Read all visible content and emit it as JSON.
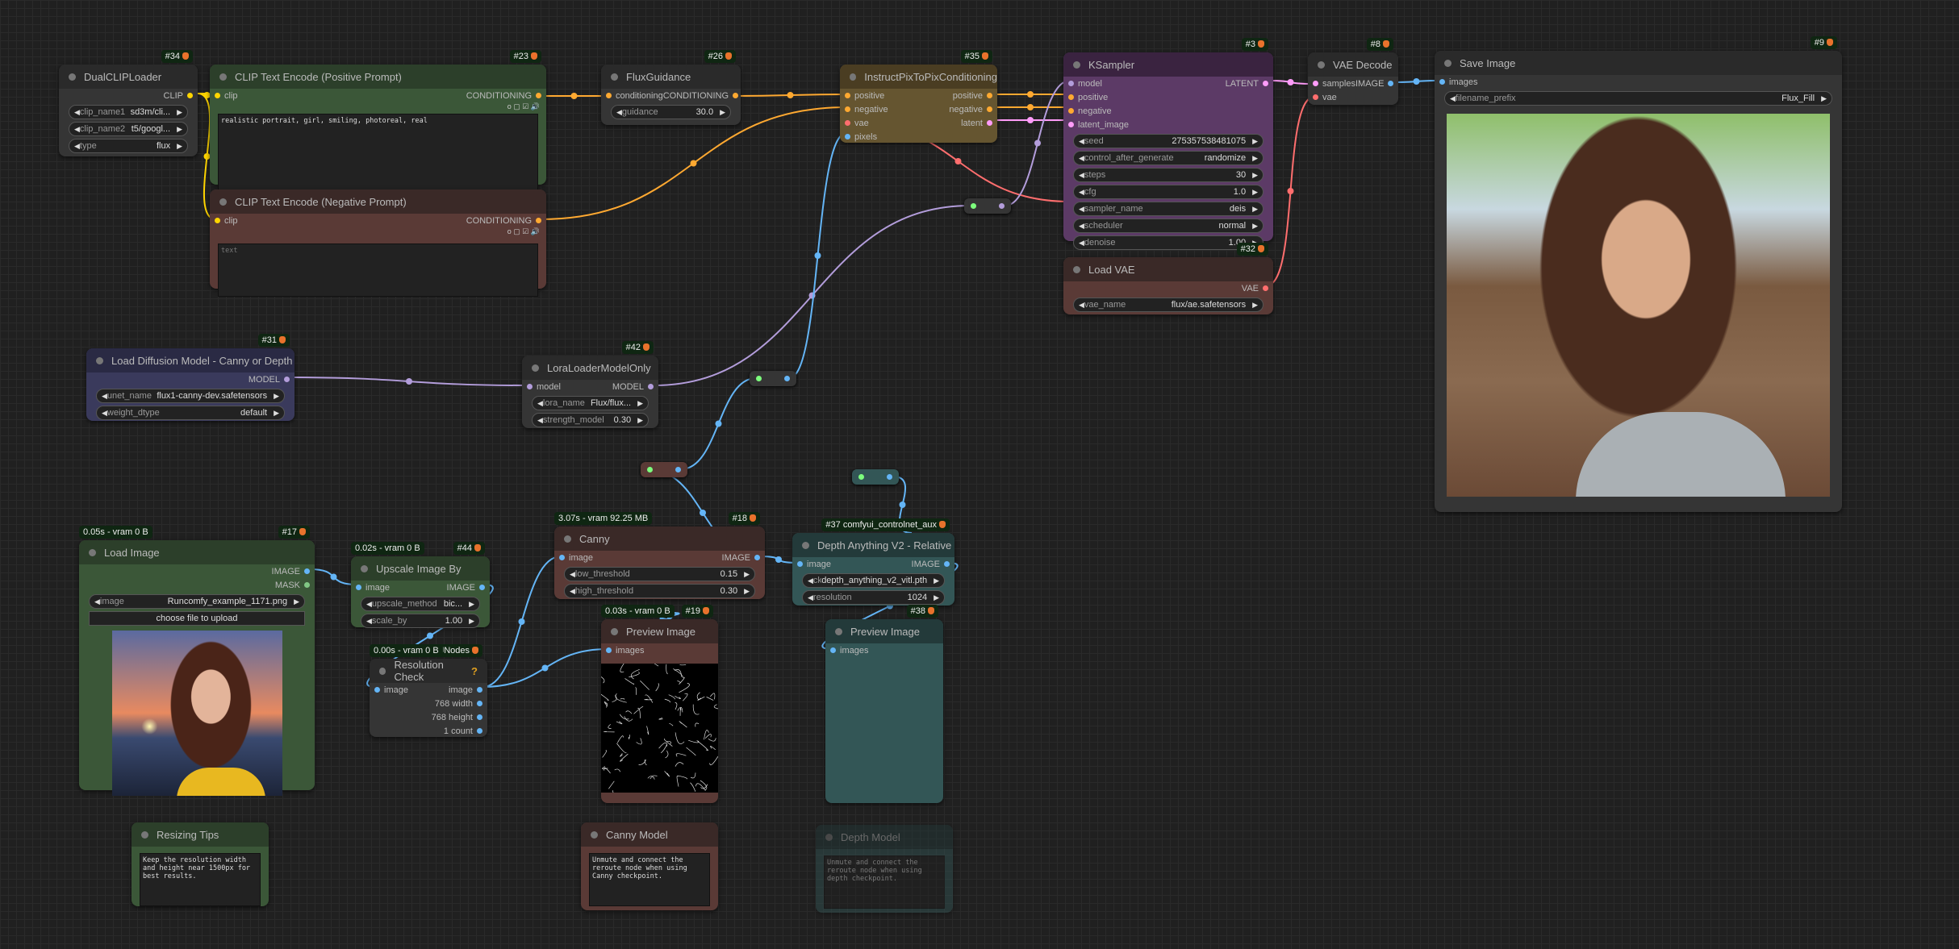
{
  "nodes": [
    {
      "id": "34",
      "key": "dualcliploader",
      "title": "DualCLIPLoader",
      "badge": "#34",
      "inputs": [],
      "outputs": [
        {
          "name": "CLIP",
          "type": "CLIP"
        }
      ],
      "widgets": [
        {
          "label": "clip_name1",
          "value": "sd3m/cli..."
        },
        {
          "label": "clip_name2",
          "value": "t5/googl..."
        },
        {
          "label": "type",
          "value": "flux"
        }
      ]
    },
    {
      "id": "23",
      "key": "clip-text-encode-positive",
      "title": "CLIP Text Encode (Positive Prompt)",
      "badge": "#23",
      "inputs": [
        {
          "name": "clip",
          "type": "CLIP"
        }
      ],
      "outputs": [
        {
          "name": "CONDITIONING",
          "type": "CONDITIONING"
        }
      ],
      "toggles": "o ▢ ☑ 🔊",
      "text": "realistic portrait, girl, smiling, photoreal, real",
      "placeholder": ""
    },
    {
      "id": "neg",
      "key": "clip-text-encode-negative",
      "title": "CLIP Text Encode (Negative Prompt)",
      "inputs": [
        {
          "name": "clip",
          "type": "CLIP"
        }
      ],
      "outputs": [
        {
          "name": "CONDITIONING",
          "type": "CONDITIONING"
        }
      ],
      "toggles": "o ▢ ☑ 🔊",
      "text": "",
      "placeholder": "text"
    },
    {
      "id": "26",
      "key": "fluxguidance",
      "title": "FluxGuidance",
      "badge": "#26",
      "inputs": [
        {
          "name": "conditioning",
          "type": "CONDITIONING"
        }
      ],
      "outputs": [
        {
          "name": "CONDITIONING",
          "type": "CONDITIONING"
        }
      ],
      "widgets": [
        {
          "label": "guidance",
          "value": "30.0"
        }
      ]
    },
    {
      "id": "35",
      "key": "instructpixtopixconditioning",
      "title": "InstructPixToPixConditioning",
      "badge": "#35",
      "inputs": [
        {
          "name": "positive",
          "type": "CONDITIONING"
        },
        {
          "name": "negative",
          "type": "CONDITIONING"
        },
        {
          "name": "vae",
          "type": "VAE"
        },
        {
          "name": "pixels",
          "type": "IMAGE"
        }
      ],
      "outputs": [
        {
          "name": "positive",
          "type": "CONDITIONING"
        },
        {
          "name": "negative",
          "type": "CONDITIONING"
        },
        {
          "name": "latent",
          "type": "LATENT"
        }
      ]
    },
    {
      "id": "3",
      "key": "ksampler",
      "title": "KSampler",
      "badge": "#3",
      "inputs": [
        {
          "name": "model",
          "type": "MODEL"
        },
        {
          "name": "positive",
          "type": "CONDITIONING"
        },
        {
          "name": "negative",
          "type": "CONDITIONING"
        },
        {
          "name": "latent_image",
          "type": "LATENT"
        }
      ],
      "outputs": [
        {
          "name": "LATENT",
          "type": "LATENT"
        }
      ],
      "widgets": [
        {
          "label": "seed",
          "value": "275357538481075"
        },
        {
          "label": "control_after_generate",
          "value": "randomize"
        },
        {
          "label": "steps",
          "value": "30"
        },
        {
          "label": "cfg",
          "value": "1.0"
        },
        {
          "label": "sampler_name",
          "value": "deis"
        },
        {
          "label": "scheduler",
          "value": "normal"
        },
        {
          "label": "denoise",
          "value": "1.00"
        }
      ]
    },
    {
      "id": "32",
      "key": "load-vae",
      "title": "Load VAE",
      "badge": "#32",
      "inputs": [],
      "outputs": [
        {
          "name": "VAE",
          "type": "VAE"
        }
      ],
      "widgets": [
        {
          "label": "vae_name",
          "value": "flux/ae.safetensors"
        }
      ]
    },
    {
      "id": "8",
      "key": "vae-decode",
      "title": "VAE Decode",
      "badge": "#8",
      "inputs": [
        {
          "name": "samples",
          "type": "LATENT"
        },
        {
          "name": "vae",
          "type": "VAE"
        }
      ],
      "outputs": [
        {
          "name": "IMAGE",
          "type": "IMAGE"
        }
      ]
    },
    {
      "id": "9",
      "key": "save-image",
      "title": "Save Image",
      "badge": "#9",
      "inputs": [
        {
          "name": "images",
          "type": "IMAGE"
        }
      ],
      "outputs": [],
      "widgets": [
        {
          "label": "filename_prefix",
          "value": "Flux_Fill"
        }
      ],
      "image": "save"
    },
    {
      "id": "31",
      "key": "load-diffusion-model",
      "title": "Load Diffusion Model - Canny or Depth",
      "badge": "#31",
      "inputs": [],
      "outputs": [
        {
          "name": "MODEL",
          "type": "MODEL"
        }
      ],
      "widgets": [
        {
          "label": "unet_name",
          "value": "flux1-canny-dev.safetensors"
        },
        {
          "label": "weight_dtype",
          "value": "default"
        }
      ]
    },
    {
      "id": "42",
      "key": "loraloadermodelonly",
      "title": "LoraLoaderModelOnly",
      "badge": "#42",
      "inputs": [
        {
          "name": "model",
          "type": "MODEL"
        }
      ],
      "outputs": [
        {
          "name": "MODEL",
          "type": "MODEL"
        }
      ],
      "widgets": [
        {
          "label": "lora_name",
          "value": "Flux/flux..."
        },
        {
          "label": "strength_model",
          "value": "0.30"
        }
      ]
    },
    {
      "id": "17",
      "key": "load-image",
      "title": "Load Image",
      "badge": "#17",
      "timing": "0.05s - vram 0 B",
      "inputs": [],
      "outputs": [
        {
          "name": "IMAGE",
          "type": "IMAGE"
        },
        {
          "name": "MASK",
          "type": "MASK"
        }
      ],
      "widgets": [
        {
          "label": "image",
          "value": "Runcomfy_example_1171.png"
        }
      ],
      "button": "choose file to upload",
      "image": "load"
    },
    {
      "id": "44",
      "key": "upscale-image-by",
      "title": "Upscale Image By",
      "badge": "#44",
      "timing": "0.02s - vram 0 B",
      "inputs": [
        {
          "name": "image",
          "type": "IMAGE"
        }
      ],
      "outputs": [
        {
          "name": "IMAGE",
          "type": "IMAGE"
        }
      ],
      "widgets": [
        {
          "label": "upscale_method",
          "value": "bic..."
        },
        {
          "label": "scale_by",
          "value": "1.00"
        }
      ]
    },
    {
      "id": "46",
      "key": "resolution-check",
      "title": "Resolution Check",
      "badge": "#46 KJNodes",
      "timing": "0.00s - vram 0 B",
      "help": "?",
      "inputs": [
        {
          "name": "image",
          "type": "IMAGE"
        }
      ],
      "outputs": [
        {
          "name": "image",
          "type": "IMAGE"
        },
        {
          "name": "768 width",
          "type": "INT"
        },
        {
          "name": "768 height",
          "type": "INT"
        },
        {
          "name": "1 count",
          "type": "INT"
        }
      ]
    },
    {
      "id": "18",
      "key": "canny",
      "title": "Canny",
      "badge": "#18",
      "timing": "3.07s - vram 92.25 MB",
      "inputs": [
        {
          "name": "image",
          "type": "IMAGE"
        }
      ],
      "outputs": [
        {
          "name": "IMAGE",
          "type": "IMAGE"
        }
      ],
      "widgets": [
        {
          "label": "low_threshold",
          "value": "0.15"
        },
        {
          "label": "high_threshold",
          "value": "0.30"
        }
      ]
    },
    {
      "id": "37",
      "key": "depth-anything-v2",
      "title": "Depth Anything V2 - Relative",
      "badge": "#37 comfyui_controlnet_aux",
      "inputs": [
        {
          "name": "image",
          "type": "IMAGE"
        }
      ],
      "outputs": [
        {
          "name": "IMAGE",
          "type": "IMAGE"
        }
      ],
      "widgets": [
        {
          "label": "ckpt_name",
          "value": "depth_anything_v2_vitl.pth"
        },
        {
          "label": "resolution",
          "value": "1024"
        }
      ]
    },
    {
      "id": "19",
      "key": "preview-image-canny",
      "title": "Preview Image",
      "badge": "#19",
      "timing": "0.03s - vram 0 B",
      "inputs": [
        {
          "name": "images",
          "type": "IMAGE"
        }
      ],
      "outputs": [],
      "image": "canny"
    },
    {
      "id": "38",
      "key": "preview-image-depth",
      "title": "Preview Image",
      "badge": "#38",
      "inputs": [
        {
          "name": "images",
          "type": "IMAGE"
        }
      ],
      "outputs": []
    },
    {
      "id": "n1",
      "key": "note-resizing-tips",
      "title": "Resizing Tips",
      "inputs": [],
      "outputs": [],
      "text": "Keep the resolution width and height near 1500px for best results."
    },
    {
      "id": "n2",
      "key": "note-canny-model",
      "title": "Canny Model",
      "inputs": [],
      "outputs": [],
      "text": "Unmute and connect the reroute node when using Canny checkpoint."
    },
    {
      "id": "n3",
      "key": "note-depth-model",
      "title": "Depth Model",
      "inputs": [],
      "outputs": [],
      "text": "Unmute and connect the reroute node when using depth checkpoint.",
      "muted": true
    }
  ],
  "slot_colors": {
    "CLIP": "#ffd500",
    "CONDITIONING": "#ffa931",
    "MODEL": "#b39ddb",
    "LATENT": "#ff9cf9",
    "VAE": "#ff6e6e",
    "IMAGE": "#64b5f6",
    "MASK": "#81c784",
    "INT": "#64b5f6"
  }
}
